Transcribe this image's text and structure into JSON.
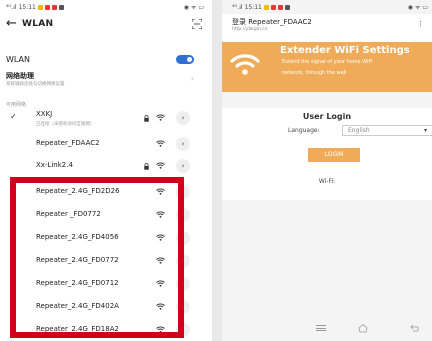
{
  "left": {
    "status": {
      "time": "15:11",
      "carrier": "⁴ᴳ.ıl"
    },
    "header": {
      "title": "WLAN"
    },
    "wlan_toggle": {
      "label": "WLAN",
      "enabled": true
    },
    "assistant": {
      "title": "网络助理",
      "subtitle": "系统辅助连接与切换网络设置"
    },
    "section_label": "可用网络",
    "networks": [
      {
        "name": "XXKJ",
        "subtitle": "已连接（未授权访问互联网）",
        "locked": true,
        "connected": true
      },
      {
        "name": "Repeater_FDAAC2",
        "locked": false
      },
      {
        "name": "Xx-Link2.4",
        "locked": true
      },
      {
        "name": "Repeater_2.4G_FD2D26",
        "locked": false
      },
      {
        "name": "Repeater _FD0772",
        "locked": false
      },
      {
        "name": "Repeater_2.4G_FD4056",
        "locked": false
      },
      {
        "name": "Repeater_2.4G_FD0772",
        "locked": false
      },
      {
        "name": "Repeater_2.4G_FD0712",
        "locked": false
      },
      {
        "name": "Repeater_2.4G_FD402A",
        "locked": false
      },
      {
        "name": "Repeater_2.4G_FD18A2",
        "locked": false
      }
    ],
    "highlight_color": "#d0021b",
    "accent_color": "#2f6fd6"
  },
  "right": {
    "status": {
      "time": "15:11",
      "carrier": "⁴ᴳ.ıl"
    },
    "header": {
      "title": "登录 Repeater_FDAAC2",
      "url": "http://ybkgin.cn"
    },
    "banner": {
      "title": "Extender WiFi Settings",
      "desc1": "Extend the signal of your home WiFi",
      "desc2": "network, through the wall",
      "color": "#f0ab58"
    },
    "login": {
      "title": "User Login",
      "language_label": "Language:",
      "language_value": "English",
      "button": "LOGIN",
      "wifi_label": "Wi-Fi:"
    }
  }
}
